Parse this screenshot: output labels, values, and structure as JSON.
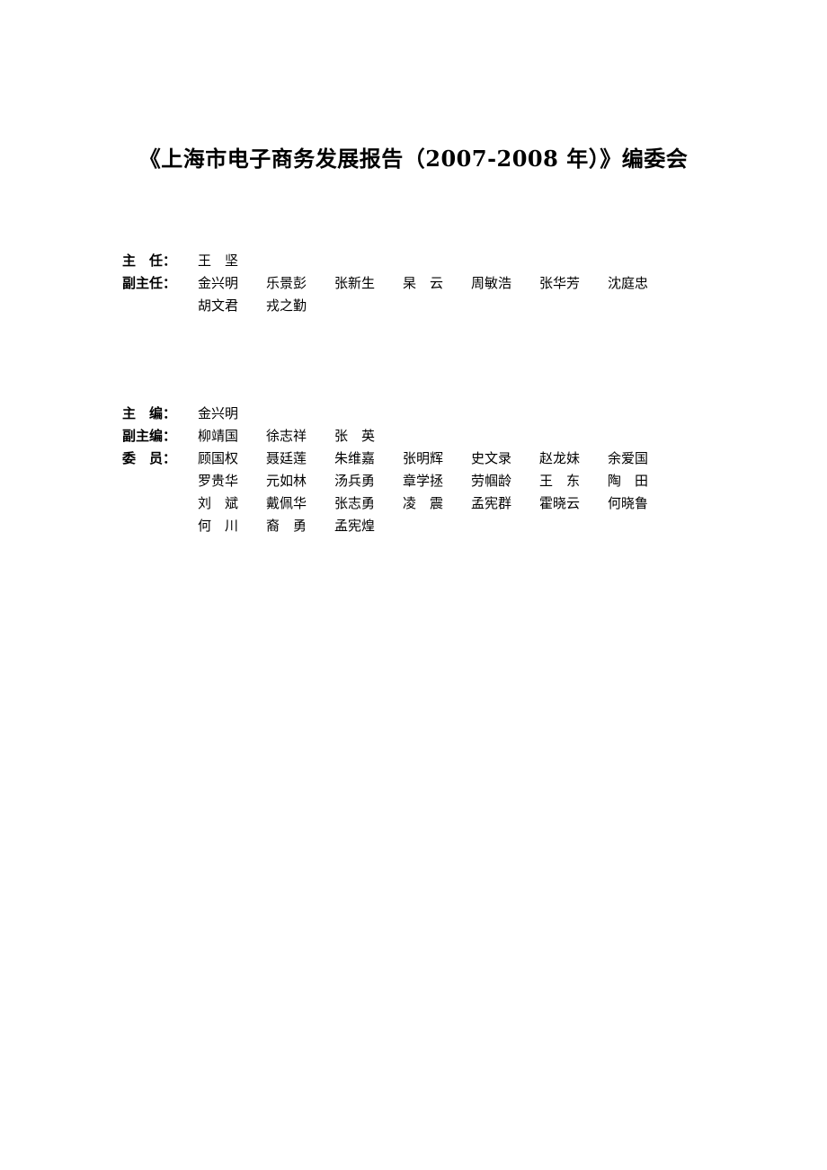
{
  "document": {
    "title": "《上海市电子商务发展报告（2007-2008 年）》编委会",
    "background_color": "#ffffff",
    "text_color": "#000000"
  },
  "blocks": [
    {
      "id": "leadership",
      "rows": [
        {
          "label": "主　任：",
          "names": [
            "王　坚"
          ]
        },
        {
          "label": "副主任：",
          "names": [
            "金兴明",
            "乐景彭",
            "张新生",
            "杲　云",
            "周敏浩",
            "张华芳",
            "沈庭忠"
          ]
        },
        {
          "label": "",
          "names": [
            "胡文君",
            "戎之勤"
          ]
        }
      ]
    },
    {
      "id": "editorial",
      "rows": [
        {
          "label": "主　编：",
          "names": [
            "金兴明"
          ]
        },
        {
          "label": "副主编：",
          "names": [
            "柳靖国",
            "徐志祥",
            "张　英"
          ]
        },
        {
          "label": "委　员：",
          "names": [
            "顾国权",
            "聂廷莲",
            "朱维嘉",
            "张明辉",
            "史文录",
            "赵龙妹",
            "余爱国"
          ]
        },
        {
          "label": "",
          "names": [
            "罗贵华",
            "元如林",
            "汤兵勇",
            "章学拯",
            "劳帼龄",
            "王　东",
            "陶　田"
          ]
        },
        {
          "label": "",
          "names": [
            "刘　斌",
            "戴佩华",
            "张志勇",
            "凌　震",
            "孟宪群",
            "霍晓云",
            "何晓鲁"
          ]
        },
        {
          "label": "",
          "names": [
            "何　川",
            "裔　勇",
            "孟宪煌"
          ]
        }
      ]
    }
  ]
}
